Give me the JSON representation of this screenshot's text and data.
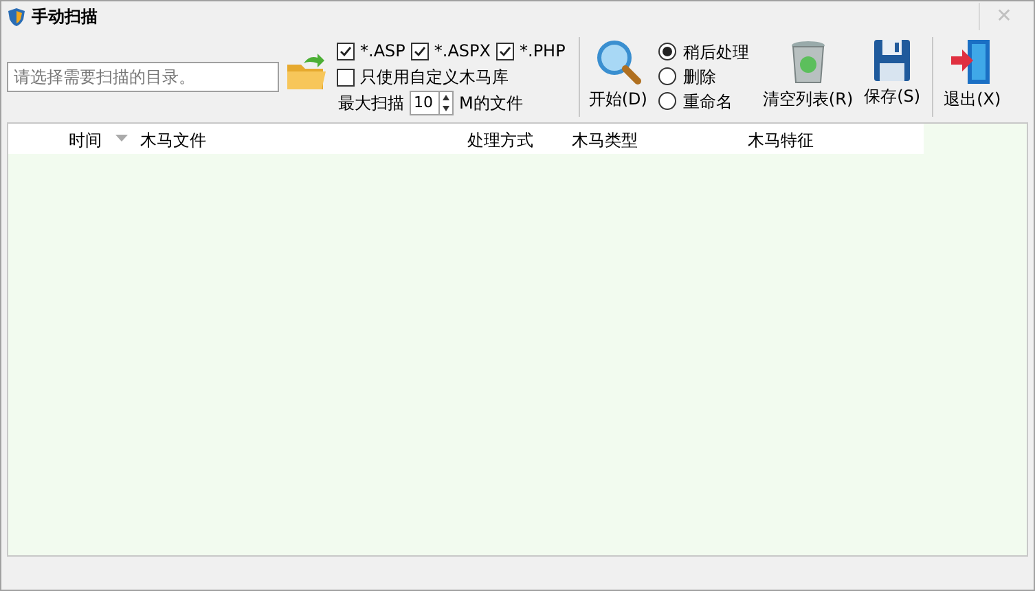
{
  "window": {
    "title": "手动扫描",
    "close": "✕"
  },
  "path_field": {
    "placeholder": "请选择需要扫描的目录。"
  },
  "extensions": [
    {
      "label": "*.ASP",
      "checked": true
    },
    {
      "label": "*.ASPX",
      "checked": true
    },
    {
      "label": "*.PHP",
      "checked": true
    }
  ],
  "custom_library": {
    "label": "只使用自定义木马库",
    "checked": false
  },
  "max_scan": {
    "label": "最大扫描",
    "value": "10",
    "unit": "M的文件"
  },
  "start_button": "开始(D)",
  "actions": [
    {
      "label": "稍后处理",
      "selected": true
    },
    {
      "label": "删除",
      "selected": false
    },
    {
      "label": "重命名",
      "selected": false
    }
  ],
  "tool_buttons": [
    {
      "kind": "trash",
      "label": "清空列表(R)"
    },
    {
      "kind": "save",
      "label": "保存(S)"
    }
  ],
  "exit_button": "退出(X)",
  "table": {
    "columns": [
      {
        "label": "时间",
        "sorted": true
      },
      {
        "label": "木马文件",
        "sorted": false
      },
      {
        "label": "处理方式",
        "sorted": false
      },
      {
        "label": "木马类型",
        "sorted": false
      },
      {
        "label": "木马特征",
        "sorted": false
      }
    ]
  }
}
